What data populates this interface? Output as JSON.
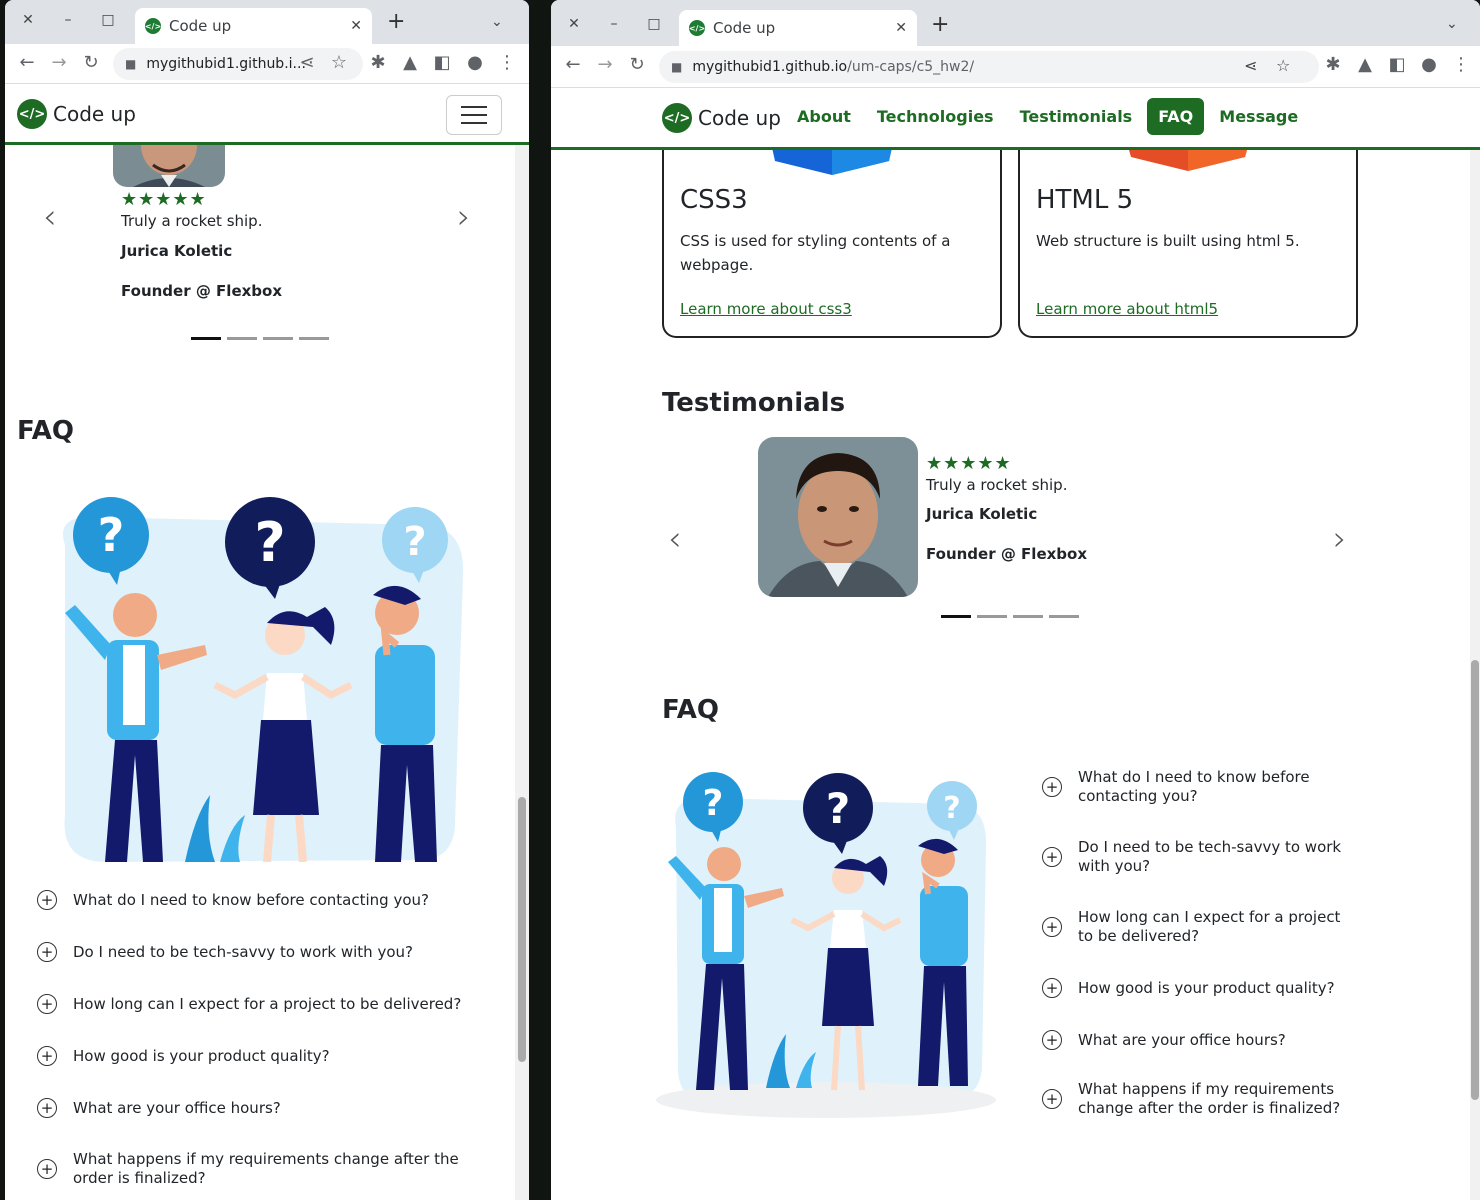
{
  "browser": {
    "tab_title": "Code up",
    "url_short": "mygithubid1.github.i...",
    "url_host": "mygithubid1.github.io",
    "url_path": "/um-caps/c5_hw2/"
  },
  "site": {
    "brand": "Code up",
    "logo_glyph": "</>",
    "nav": [
      "About",
      "Technologies",
      "Testimonials",
      "FAQ",
      "Message"
    ],
    "active_nav": "FAQ"
  },
  "cards": [
    {
      "title": "CSS3",
      "text": "CSS is used for styling contents of a webpage.",
      "link": "Learn more about css3",
      "accent": "#1565d8"
    },
    {
      "title": "HTML 5",
      "text": "Web structure is built using html 5.",
      "link": "Learn more about html5",
      "accent": "#e44d26"
    }
  ],
  "testimonials": {
    "heading": "Testimonials",
    "stars": "★★★★★",
    "quote": "Truly a rocket ship.",
    "name": "Jurica Koletic",
    "role": "Founder @ Flexbox",
    "slides": 4,
    "active_slide": 1
  },
  "faq": {
    "heading": "FAQ",
    "questions": [
      "What do I need to know before contacting you?",
      "Do I need to be tech-savvy to work with you?",
      "How long can I expect for a project to be delivered?",
      "How good is your product quality?",
      "What are your office hours?",
      "What happens if my requirements change after the order is finalized?"
    ]
  },
  "icons": {
    "close": "✕",
    "minimize": "–",
    "maximize": "□",
    "new_tab": "+",
    "back": "←",
    "forward": "→",
    "reload": "↻",
    "lock": "🔒",
    "share": "⋖",
    "star": "☆",
    "extensions": "✱",
    "lab": "▲",
    "sidepanel": "◧",
    "profile": "●",
    "menu": "⋮",
    "prev": "‹",
    "next": "›",
    "plus": "+"
  }
}
